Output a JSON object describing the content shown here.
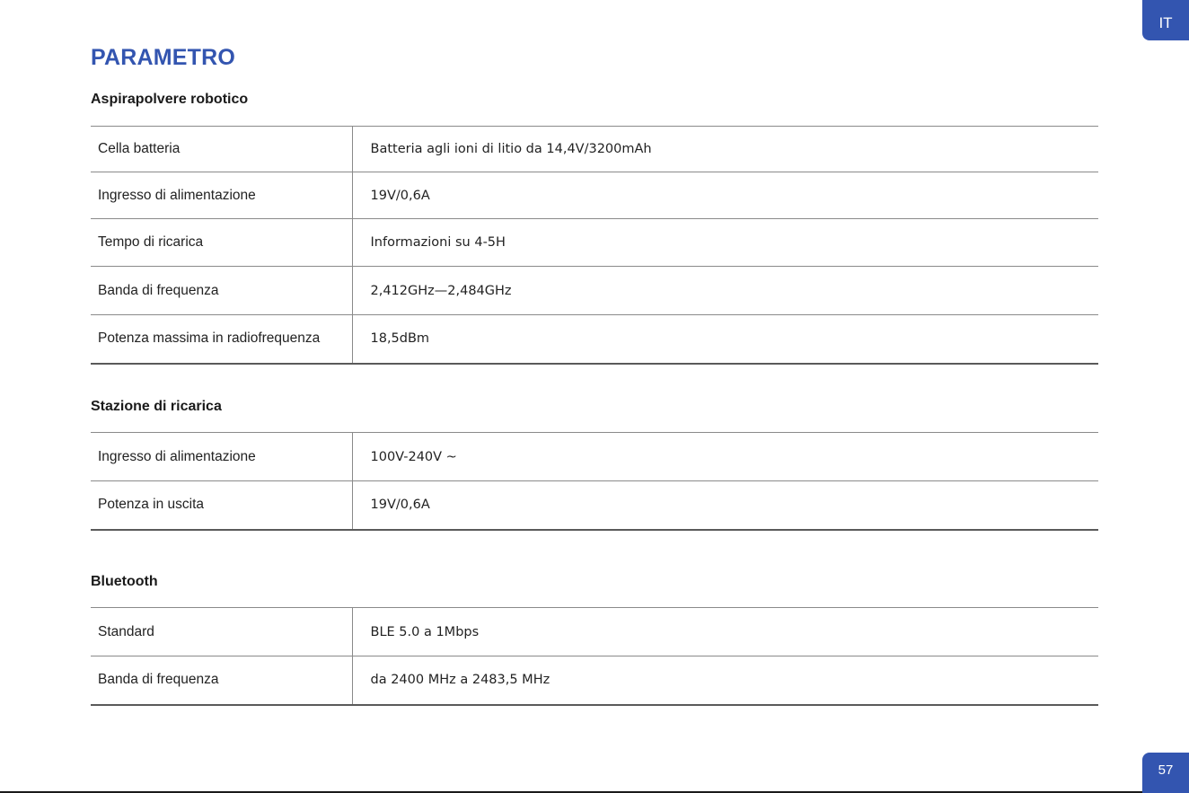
{
  "page": {
    "lang_tab": "IT",
    "page_number": "57",
    "title": "PARAMETRO"
  },
  "sections": [
    {
      "title": "Aspirapolvere robotico",
      "rows": [
        {
          "label": "Cella batteria",
          "value": "Batteria agli ioni di litio da 14,4V/3200mAh"
        },
        {
          "label": "Ingresso di alimentazione",
          "value": "19V/0,6A"
        },
        {
          "label": "Tempo di ricarica",
          "value": "Informazioni su 4-5H"
        },
        {
          "label": "Banda di frequenza",
          "value": "2,412GHz—2,484GHz"
        },
        {
          "label": "Potenza massima in radiofrequenza",
          "value": "18,5dBm"
        }
      ]
    },
    {
      "title": "Stazione di ricarica",
      "rows": [
        {
          "label": "Ingresso di alimentazione",
          "value": "100V-240V ~"
        },
        {
          "label": "Potenza in uscita",
          "value": "19V/0,6A"
        }
      ]
    },
    {
      "title": "Bluetooth",
      "rows": [
        {
          "label": "Standard",
          "value": "BLE 5.0 a 1Mbps"
        },
        {
          "label": "Banda di frequenza",
          "value": "da 2400 MHz a 2483,5 MHz"
        }
      ]
    }
  ]
}
